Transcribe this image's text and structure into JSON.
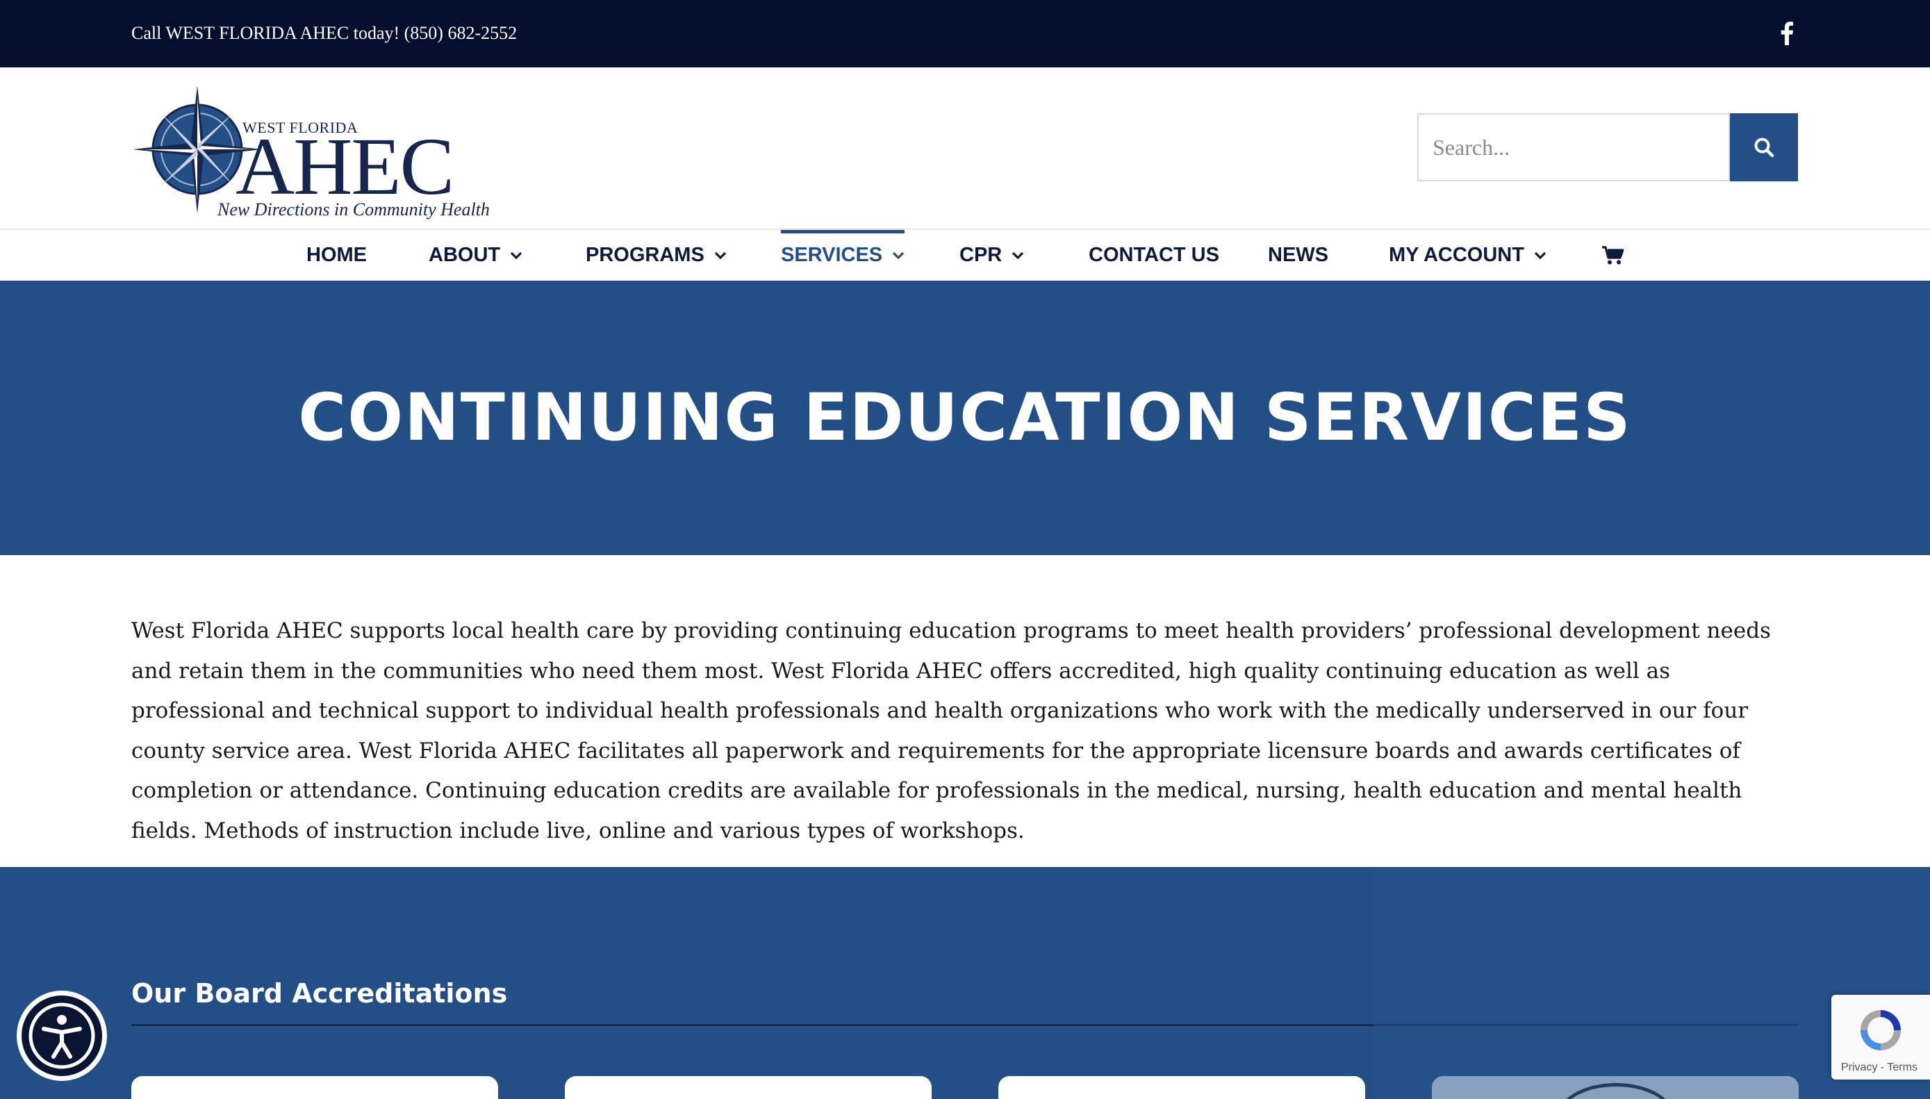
{
  "topbar": {
    "phone_text": "Call WEST FLORIDA AHEC today! (850) 682-2552",
    "facebook_icon": "facebook-icon"
  },
  "header": {
    "logo": {
      "line1": "WEST FLORIDA",
      "line2": "AHEC",
      "tagline": "New Directions in Community Health"
    },
    "search": {
      "placeholder": "Search...",
      "value": "",
      "button_icon": "search-icon"
    }
  },
  "nav": {
    "items": [
      {
        "label": "HOME",
        "has_dropdown": false
      },
      {
        "label": "ABOUT",
        "has_dropdown": true
      },
      {
        "label": "PROGRAMS",
        "has_dropdown": true
      },
      {
        "label": "SERVICES",
        "has_dropdown": true,
        "active": true
      },
      {
        "label": "CPR",
        "has_dropdown": true
      },
      {
        "label": "CONTACT US",
        "has_dropdown": false
      },
      {
        "label": "NEWS",
        "has_dropdown": false
      },
      {
        "label": "MY ACCOUNT",
        "has_dropdown": true
      }
    ],
    "cart_icon": "cart-icon"
  },
  "hero": {
    "title": "CONTINUING EDUCATION SERVICES"
  },
  "intro": {
    "text": "West Florida AHEC supports local health care by providing continuing education programs to meet health providers’ professional development needs and retain them in the communities who need them most. West Florida AHEC offers accredited, high quality continuing education as well as professional and technical support to individual health professionals and health organizations who work with the medically underserved in our four county service area. West Florida AHEC facilitates all paperwork and requirements for the appropriate licensure boards and awards certificates of completion or attendance. Continuing education credits are available for professionals in the medical, nursing, health education and mental health fields. Methods of instruction include live, online and various types of workshops."
  },
  "accreditations": {
    "heading": "Our Board Accreditations"
  },
  "widgets": {
    "accessibility_icon": "accessibility-icon",
    "recaptcha_terms": "Privacy - Terms"
  },
  "colors": {
    "topbar_bg": "#050f2d",
    "brand_blue": "#234f86",
    "nav_text": "#0d1a3a"
  }
}
